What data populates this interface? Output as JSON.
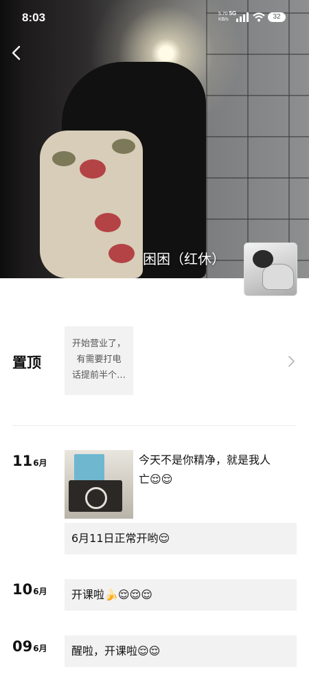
{
  "status_bar": {
    "time": "8:03",
    "net_speed": "5.70",
    "net_unit": "KB/s",
    "network": "5G",
    "battery": "32"
  },
  "profile": {
    "name": "困困（红休）"
  },
  "pinned": {
    "label": "置顶",
    "preview": [
      "开始营业了，",
      "有需要打电",
      "话提前半个…"
    ]
  },
  "posts": [
    {
      "day": "11",
      "month": "6月",
      "text_lines": [
        "今天不是你精净，就是我人",
        "亡😌😌"
      ],
      "bubble": "6月11日正常开哟😌"
    },
    {
      "day": "10",
      "month": "6月",
      "bubble": "开课啦🍌😌😌😌"
    },
    {
      "day": "09",
      "month": "6月",
      "bubble": "醒啦，开课啦😌😌"
    }
  ]
}
